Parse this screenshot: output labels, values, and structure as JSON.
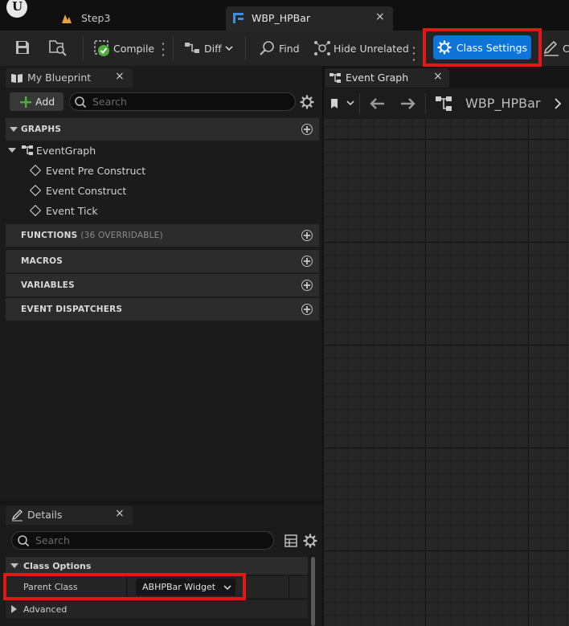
{
  "document_tabs": [
    {
      "label": "Step3",
      "icon": "blueprint-level-icon"
    },
    {
      "label": "WBP_HPBar",
      "icon": "widget-blueprint-icon",
      "close": "×"
    }
  ],
  "toolbar": {
    "compile": "Compile",
    "diff": "Diff",
    "find": "Find",
    "hide_unrelated": "Hide Unrelated",
    "class_settings": "Class Settings",
    "truncated": "C"
  },
  "my_blueprint": {
    "tab_label": "My Blueprint",
    "close": "×",
    "add_label": "Add",
    "search_placeholder": "Search",
    "sections": {
      "graphs": "GRAPHS",
      "functions": "FUNCTIONS",
      "functions_count": "(36 OVERRIDABLE)",
      "macros": "MACROS",
      "variables": "VARIABLES",
      "event_dispatchers": "EVENT DISPATCHERS"
    },
    "event_graph": "EventGraph",
    "events": [
      "Event Pre Construct",
      "Event Construct",
      "Event Tick"
    ]
  },
  "event_graph": {
    "tab_label": "Event Graph",
    "close": "×",
    "breadcrumb": "WBP_HPBar"
  },
  "details": {
    "tab_label": "Details",
    "close": "×",
    "search_placeholder": "Search",
    "class_options": "Class Options",
    "parent_class_label": "Parent Class",
    "parent_class_value": "ABHPBar Widget",
    "advanced": "Advanced"
  },
  "colors": {
    "accent": "#0e74d8",
    "highlight": "#e01818",
    "compile_ok": "#4caf3a",
    "add_plus": "#4caf3a"
  }
}
